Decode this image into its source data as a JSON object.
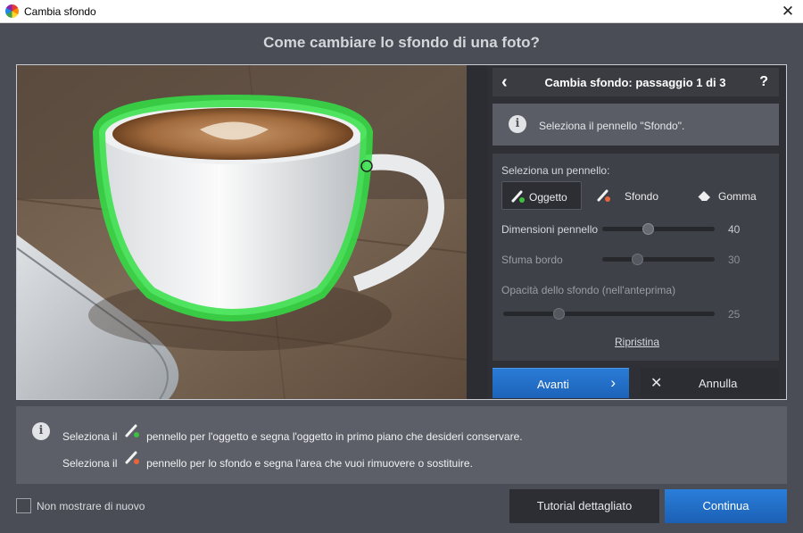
{
  "window": {
    "title": "Cambia sfondo",
    "close_icon": "close-icon"
  },
  "heading": "Come cambiare lo sfondo di una foto?",
  "panel": {
    "title": "Cambia sfondo: passaggio 1 di 3",
    "back_icon": "chevron-left-icon",
    "help_label": "?",
    "info_text": "Seleziona il pennello \"Sfondo\".",
    "brush_label": "Seleziona un pennello:",
    "brushes": [
      {
        "label": "Oggetto",
        "icon": "brush-object-icon",
        "dot_color": "#3fbf3f",
        "selected": true
      },
      {
        "label": "Sfondo",
        "icon": "brush-background-icon",
        "dot_color": "#e8643a",
        "selected": false
      },
      {
        "label": "Gomma",
        "icon": "eraser-icon",
        "selected": false
      }
    ],
    "sliders": [
      {
        "label": "Dimensioni pennello",
        "value": "40",
        "enabled": true
      },
      {
        "label": "Sfuma bordo",
        "value": "30",
        "enabled": false
      },
      {
        "label": "Opacità dello sfondo (nell'anteprima)",
        "value": "25",
        "enabled": false
      }
    ],
    "reset_label": "Ripristina",
    "next_label": "Avanti",
    "cancel_label": "Annulla"
  },
  "tips": [
    {
      "prefix": "Seleziona il",
      "suffix": "pennello per l'oggetto e segna l'oggetto in primo piano che desideri conservare.",
      "dot_color": "#3fbf3f"
    },
    {
      "prefix": "Seleziona il",
      "suffix": "pennello per lo sfondo e segna l'area che vuoi rimuovere o sostituire.",
      "dot_color": "#e8643a"
    }
  ],
  "footer": {
    "dont_show_label": "Non mostrare di nuovo",
    "dont_show_checked": false,
    "tutorial_label": "Tutorial dettagliato",
    "continue_label": "Continua"
  },
  "colors": {
    "accent": "#1f6fcf",
    "object_mark": "#33e045",
    "background_mark": "#e8643a"
  }
}
